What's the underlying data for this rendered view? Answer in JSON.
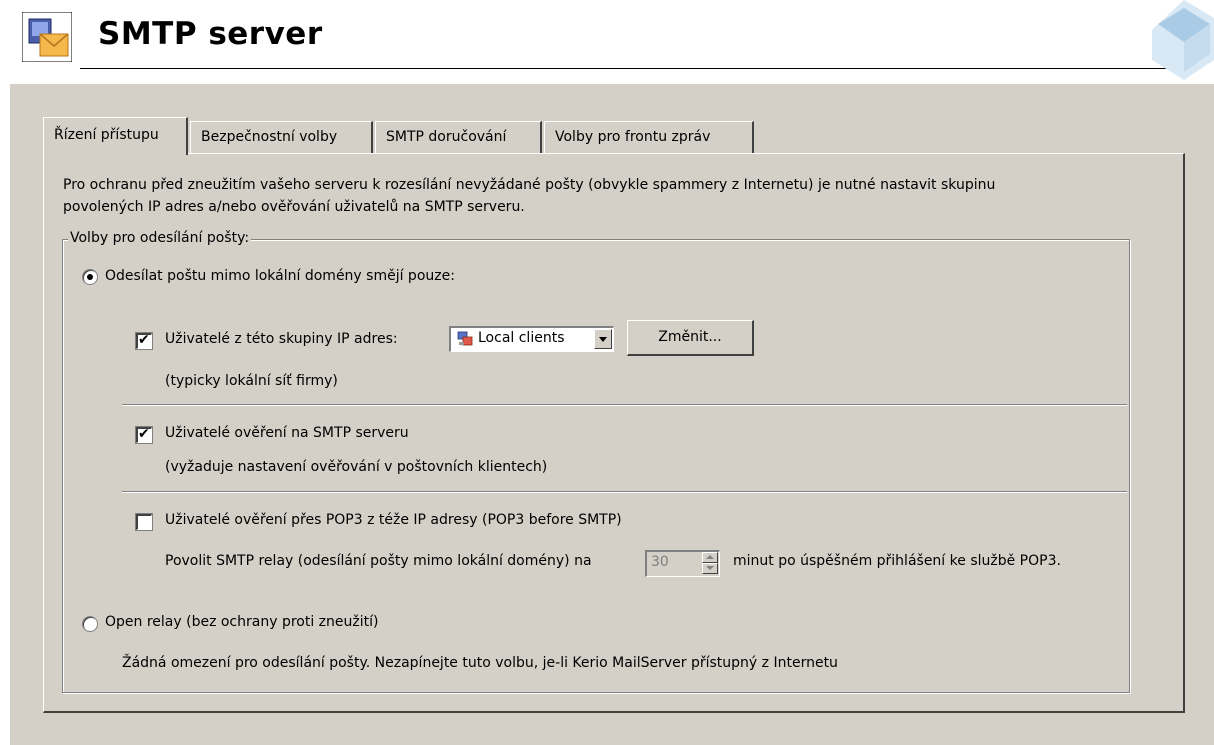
{
  "header": {
    "title": "SMTP server"
  },
  "tabs": [
    {
      "label": "Řízení přístupu",
      "active": true
    },
    {
      "label": "Bezpečnostní volby",
      "active": false
    },
    {
      "label": "SMTP doručování",
      "active": false
    },
    {
      "label": "Volby pro frontu zpráv",
      "active": false
    }
  ],
  "intro": {
    "line1": "Pro ochranu před zneužitím vašeho serveru k rozesílání nevyžádané pošty (obvykle spammery z Internetu) je nutné nastavit skupinu",
    "line2": "povolených IP adres a/nebo ověřování uživatelů na SMTP serveru."
  },
  "group": {
    "label": "Volby pro odesílání pošty:",
    "restrict": {
      "label": "Odesílat poštu mimo lokální domény smějí pouze:",
      "selected": true,
      "ip_group": {
        "checked": true,
        "label": "Uživatelé z této skupiny IP adres:",
        "combo_value": "Local clients",
        "change_button": "Změnit...",
        "hint": "(typicky lokální síť firmy)"
      },
      "auth": {
        "checked": true,
        "label": "Uživatelé ověření na SMTP serveru",
        "hint": "(vyžaduje nastavení ověřování v poštovních klientech)"
      },
      "pop3": {
        "checked": false,
        "label": "Uživatelé ověření přes POP3 z téže IP adresy (POP3 before SMTP)",
        "relay_prefix": "Povolit SMTP relay (odesílání pošty mimo lokální domény) na",
        "minutes": "30",
        "relay_suffix": "minut po úspěšném přihlášení ke službě POP3."
      }
    },
    "open_relay": {
      "label": "Open relay (bez ochrany proti zneužití)",
      "selected": false,
      "hint": "Žádná omezení pro odesílání pošty. Nezapínejte tuto volbu, je-li Kerio MailServer přístupný z Internetu"
    }
  }
}
